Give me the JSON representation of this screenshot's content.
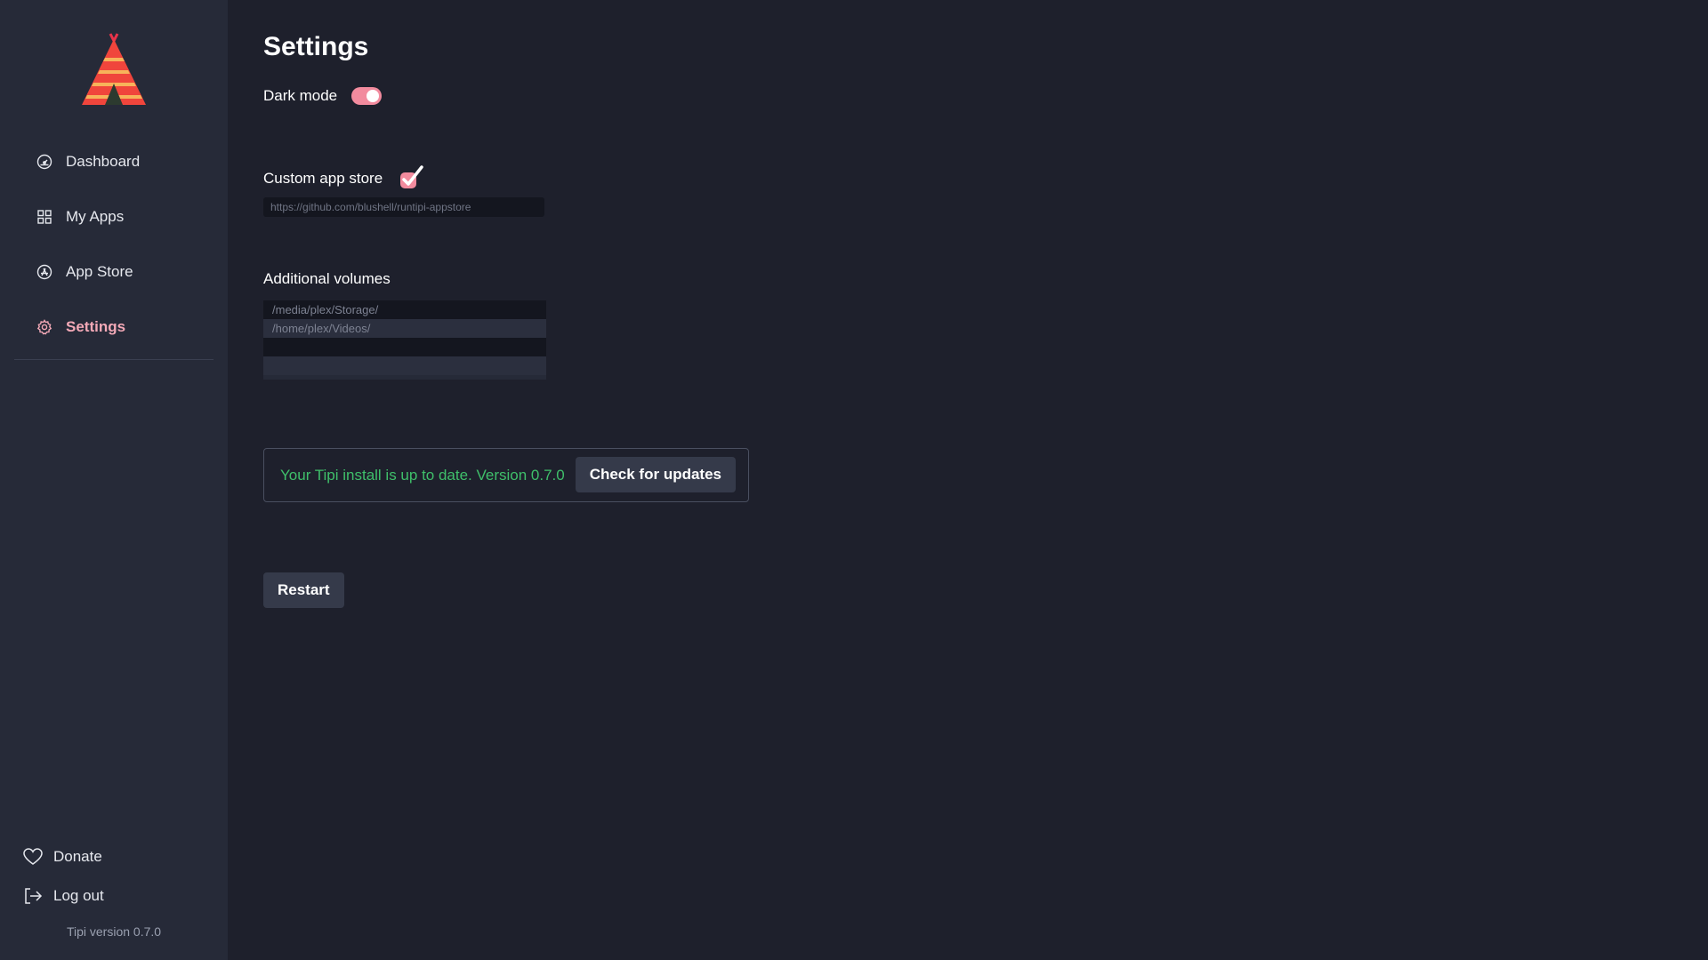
{
  "sidebar": {
    "logo": "tipi-logo",
    "items": [
      {
        "label": "Dashboard",
        "icon": "gauge-icon",
        "active": false
      },
      {
        "label": "My Apps",
        "icon": "grid-icon",
        "active": false
      },
      {
        "label": "App Store",
        "icon": "app-store-icon",
        "active": false
      },
      {
        "label": "Settings",
        "icon": "gear-icon",
        "active": true
      }
    ],
    "donate_label": "Donate",
    "logout_label": "Log out",
    "version_text": "Tipi version 0.7.0"
  },
  "main": {
    "title": "Settings",
    "dark_mode": {
      "label": "Dark mode",
      "enabled": true
    },
    "custom_store": {
      "label": "Custom app store",
      "checked": true,
      "placeholder": "https://github.com/blushell/runtipi-appstore"
    },
    "volumes": {
      "label": "Additional volumes",
      "rows": [
        "/media/plex/Storage/",
        "/home/plex/Videos/",
        "",
        ""
      ]
    },
    "update": {
      "status_text": "Your Tipi install is up to date. Version 0.7.0",
      "button_label": "Check for updates"
    },
    "restart_label": "Restart"
  },
  "colors": {
    "background": "#1e202c",
    "sidebar": "#262a38",
    "accent": "#f28b9e",
    "success": "#3fbf6a"
  }
}
